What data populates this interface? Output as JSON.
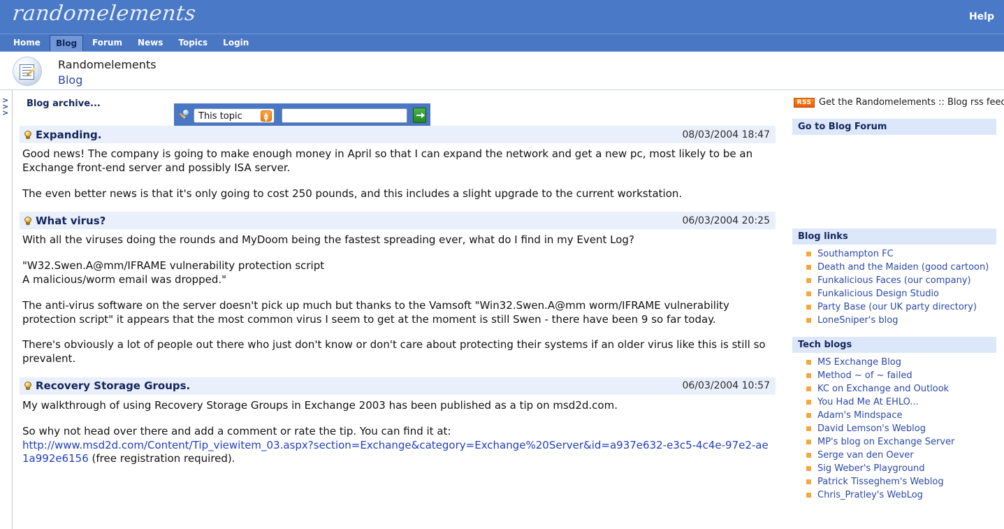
{
  "banner": {
    "logo_text": "randomelements",
    "help_label": "Help"
  },
  "nav": {
    "items": [
      {
        "label": "Home",
        "active": false
      },
      {
        "label": "Blog",
        "active": true
      },
      {
        "label": "Forum",
        "active": false
      },
      {
        "label": "News",
        "active": false
      },
      {
        "label": "Topics",
        "active": false
      },
      {
        "label": "Login",
        "active": false
      }
    ]
  },
  "subheader": {
    "site_name": "Randomelements",
    "section_name": "Blog",
    "icon": "document-with-pen-icon"
  },
  "search": {
    "scope_selected": "This topic",
    "query_value": "",
    "query_placeholder": "",
    "go_icon": "green-arrow-go-icon",
    "magnifier_icon": "search-wand-icon"
  },
  "archive": {
    "label": "Blog archive...",
    "chevrons": ">"
  },
  "posts": [
    {
      "title": "Expanding.",
      "date": "08/03/2004 18:47",
      "paragraphs": [
        "Good news! The company is going to make enough money in April so that I can expand the network and get a new pc, most likely to be an Exchange front-end server and possibly ISA server.",
        "The even better news is that it's only going to cost 250 pounds, and this includes a slight upgrade to the current workstation."
      ]
    },
    {
      "title": "What virus?",
      "date": "06/03/2004 20:25",
      "paragraphs": [
        "With all the viruses doing the rounds and MyDoom being the fastest spreading ever, what do I find in my Event Log?",
        "\"W32.Swen.A@mm/IFRAME vulnerability protection script\nA malicious/worm email was dropped.\"",
        "The anti-virus software on the server doesn't pick up much but thanks to the Vamsoft \"Win32.Swen.A@mm worm/IFRAME vulnerability protection script\" it appears that the most common virus I seem to get at the moment is still Swen - there have been 9 so far today.",
        "There's obviously a lot of people out there who just don't know or don't care about protecting their systems if an older virus like this is still so prevalent."
      ]
    },
    {
      "title": "Recovery Storage Groups.",
      "date": "06/03/2004 10:57",
      "paragraphs": [
        "My walkthrough of using Recovery Storage Groups in Exchange 2003 has been published as a tip on msd2d.com.",
        "So why not head over there and add a comment or rate the tip. You can find it at:"
      ],
      "link_text": "http://www.msd2d.com/Content/Tip_viewitem_03.aspx?section=Exchange&category=Exchange%20Server&id=a937e632-e3c5-4c4e-97e2-ae1a992e6156",
      "link_suffix": " (free registration required)."
    }
  ],
  "sidebar": {
    "rss": {
      "badge": "RSS",
      "text": "Get the Randomelements :: Blog rss feed"
    },
    "forum_panel": {
      "title": "Go to Blog Forum"
    },
    "blog_links": {
      "title": "Blog links",
      "items": [
        "Southampton FC",
        "Death and the Maiden (good cartoon)",
        "Funkalicious Faces (our company)",
        "Funkalicious Design Studio",
        "Party Base (our UK party directory)",
        "LoneSniper's blog"
      ]
    },
    "tech_blogs": {
      "title": "Tech blogs",
      "items": [
        "MS Exchange Blog",
        "Method ~ of ~ failed",
        "KC on Exchange and Outlook",
        "You Had Me At EHLO...",
        "Adam's Mindspace",
        "David Lemson's Weblog",
        "MP's blog on Exchange Server",
        "Serge van den Oever",
        "Sig Weber's Playground",
        "Patrick Tisseghem's Weblog",
        "Chris_Pratley's WebLog"
      ]
    }
  },
  "colors": {
    "banner_blue": "#4a7ac7",
    "nav_blue": "#4a77c4",
    "panel_header_blue": "#dce8fa",
    "post_header_blue": "#eaf0fb",
    "link_blue": "#2b48a8",
    "heading_navy": "#13245c",
    "bullet_orange": "#f2a93c",
    "rss_orange": "#e95b06",
    "go_green": "#1f8a22"
  }
}
